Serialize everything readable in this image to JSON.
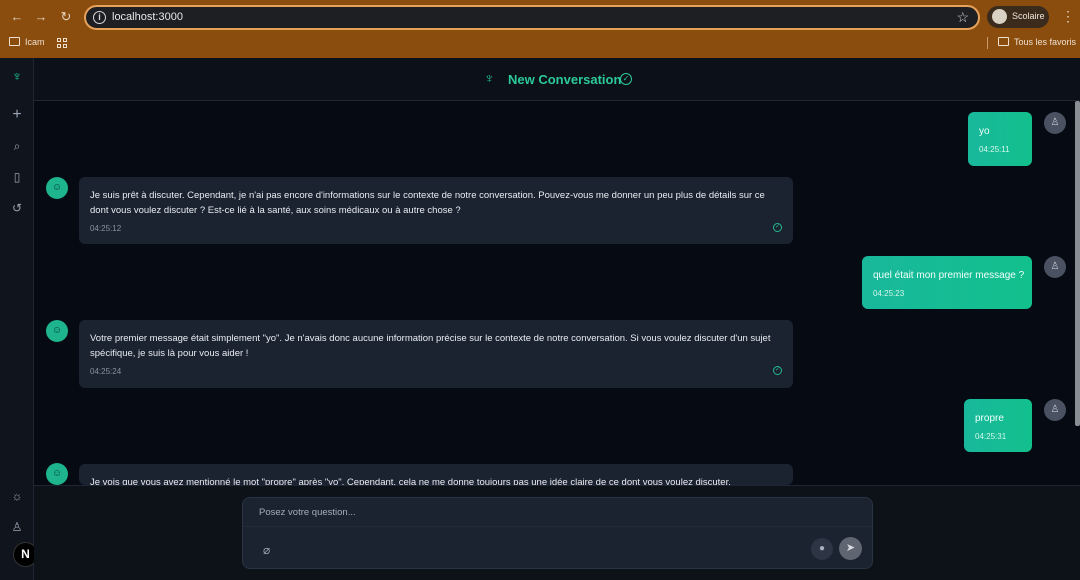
{
  "browser": {
    "url": "localhost:3000",
    "profile_name": "Scolaire",
    "bookmarks": [
      {
        "label": "Icam"
      }
    ],
    "bookmarks_right": "Tous les favoris"
  },
  "header": {
    "title": "New Conversation"
  },
  "messages": [
    {
      "role": "user",
      "text": "yo",
      "time": "04:25:11"
    },
    {
      "role": "assistant",
      "text": "Je suis prêt à discuter. Cependant, je n'ai pas encore d'informations sur le contexte de notre conversation. Pouvez-vous me donner un peu plus de détails sur ce dont vous voulez discuter ? Est-ce lié à la santé, aux soins médicaux ou à autre chose ?",
      "time": "04:25:12"
    },
    {
      "role": "user",
      "text": "quel était mon premier message ?",
      "time": "04:25:23"
    },
    {
      "role": "assistant",
      "text": "Votre premier message était simplement \"yo\". Je n'avais donc aucune information précise sur le contexte de notre conversation. Si vous voulez discuter d'un sujet spécifique, je suis là pour vous aider !",
      "time": "04:25:24"
    },
    {
      "role": "user",
      "text": "propre",
      "time": "04:25:31"
    },
    {
      "role": "assistant",
      "text": "Je vois que vous avez mentionné le mot \"propre\" après \"yo\". Cependant, cela ne me donne toujours pas une idée claire de ce dont vous voulez discuter."
    }
  ],
  "composer": {
    "placeholder": "Posez votre question..."
  },
  "sidebar": {
    "badge": "N"
  },
  "colors": {
    "accent": "#1fbf98",
    "user_bubble": "#14bc94",
    "assistant_bubble": "#1b2230",
    "chrome": "#8a4d0e"
  }
}
